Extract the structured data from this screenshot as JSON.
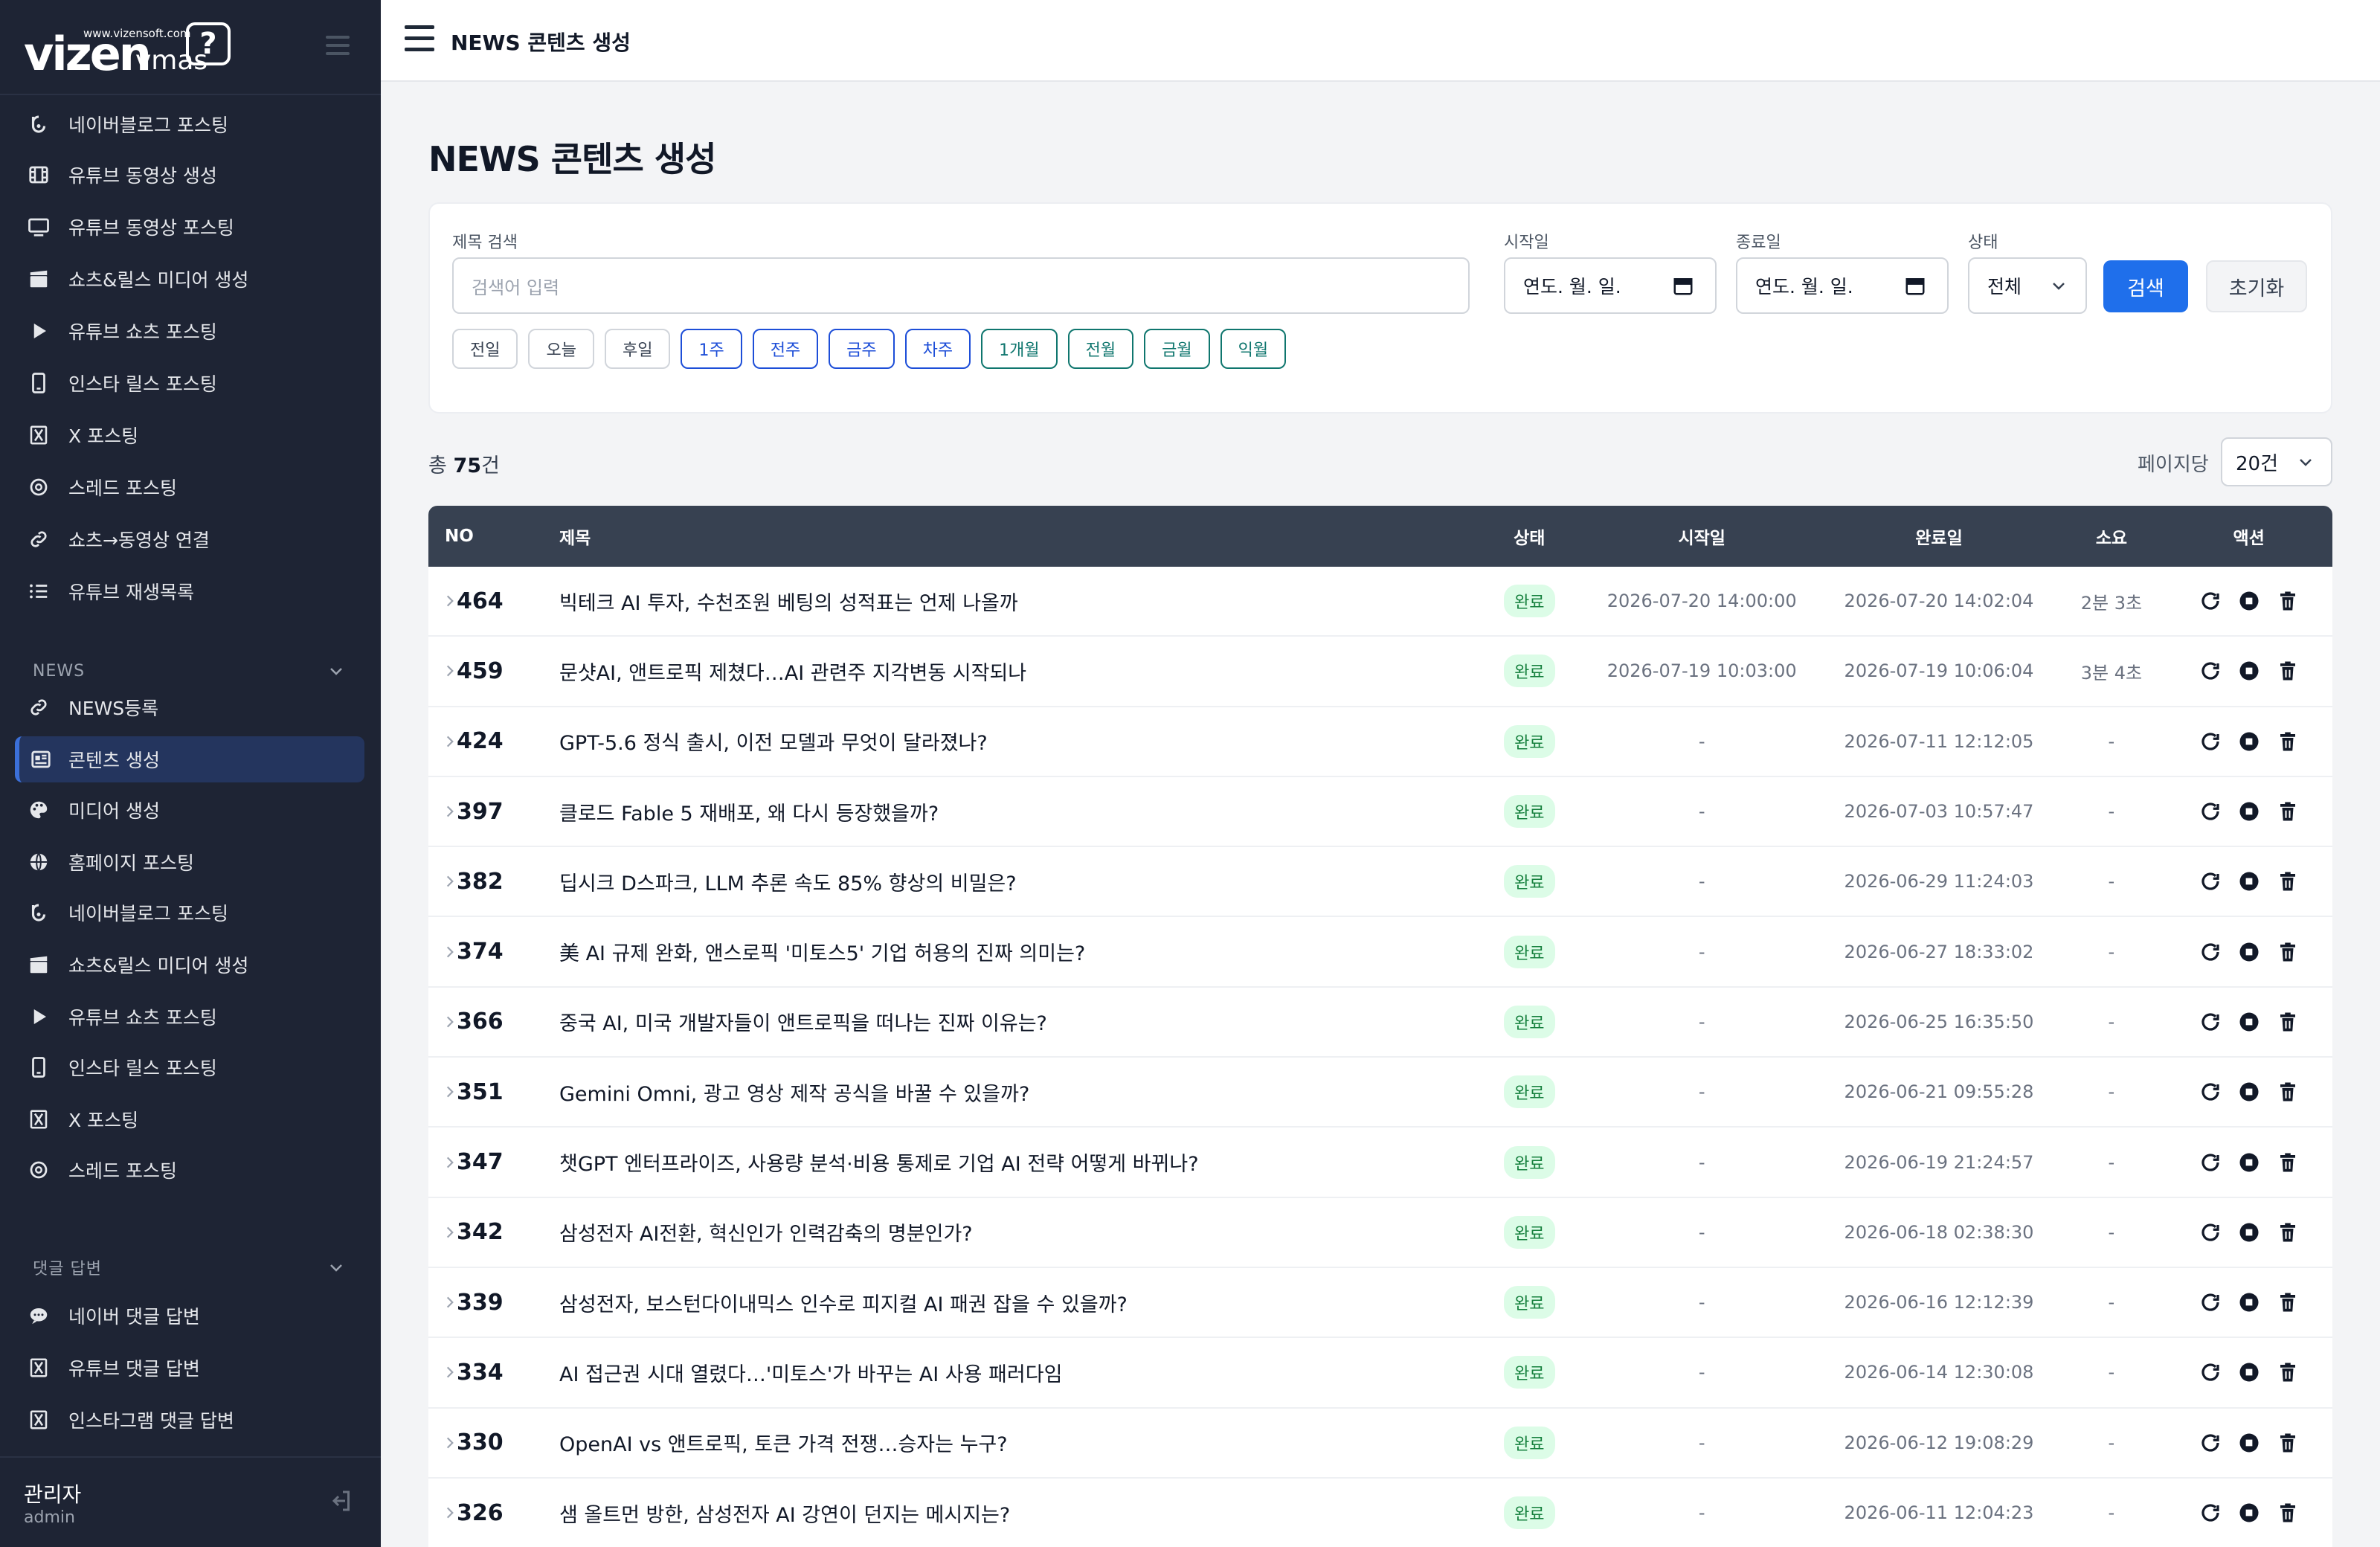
{
  "logo": {
    "url_text": "www.vizensoft.com",
    "brand": "vizen",
    "product": "vmas",
    "bubble": "?"
  },
  "sidebar": {
    "top_items": [
      {
        "label": "네이버블로그 포스팅",
        "icon": "blog-icon"
      },
      {
        "label": "유튜브 동영상 생성",
        "icon": "film-icon"
      },
      {
        "label": "유튜브 동영상 포스팅",
        "icon": "monitor-icon"
      },
      {
        "label": "쇼츠&릴스 미디어 생성",
        "icon": "clapperboard-icon"
      },
      {
        "label": "유튜브 쇼츠 포스팅",
        "icon": "play-icon"
      },
      {
        "label": "인스타 릴스 포스팅",
        "icon": "mobile-icon"
      },
      {
        "label": "X 포스팅",
        "icon": "x-logo-icon"
      },
      {
        "label": "스레드 포스팅",
        "icon": "threads-icon"
      },
      {
        "label": "쇼츠→동영상 연결",
        "icon": "link-icon"
      },
      {
        "label": "유튜브 재생목록",
        "icon": "list-icon"
      }
    ],
    "news_section": {
      "label": "NEWS",
      "items": [
        {
          "label": "NEWS등록",
          "icon": "link-icon"
        },
        {
          "label": "콘텐츠 생성",
          "icon": "newspaper-icon",
          "active": true
        },
        {
          "label": "미디어 생성",
          "icon": "palette-icon"
        },
        {
          "label": "홈페이지 포스팅",
          "icon": "globe-icon"
        },
        {
          "label": "네이버블로그 포스팅",
          "icon": "blog-icon"
        },
        {
          "label": "쇼츠&릴스 미디어 생성",
          "icon": "clapperboard-icon"
        },
        {
          "label": "유튜브 쇼츠 포스팅",
          "icon": "play-icon"
        },
        {
          "label": "인스타 릴스 포스팅",
          "icon": "mobile-icon"
        },
        {
          "label": "X 포스팅",
          "icon": "x-logo-icon"
        },
        {
          "label": "스레드 포스팅",
          "icon": "threads-icon"
        }
      ]
    },
    "reply_section": {
      "label": "댓글 답변",
      "items": [
        {
          "label": "네이버 댓글 답변",
          "icon": "comment-icon"
        },
        {
          "label": "유튜브 댓글 답변",
          "icon": "x-logo-icon"
        },
        {
          "label": "인스타그램 댓글 답변",
          "icon": "x-logo-icon"
        }
      ]
    },
    "user": {
      "name": "관리자",
      "id": "admin"
    }
  },
  "topbar": {
    "title": "NEWS 콘텐츠 생성"
  },
  "page": {
    "title": "NEWS 콘텐츠 생성"
  },
  "filters": {
    "title_label": "제목 검색",
    "title_placeholder": "검색어 입력",
    "start_label": "시작일",
    "start_value": "연도. 월. 일.",
    "end_label": "종료일",
    "end_value": "연도. 월. 일.",
    "status_label": "상태",
    "status_value": "전체",
    "search_button": "검색",
    "reset_button": "초기화",
    "chips": [
      {
        "label": "전일",
        "style": "gray"
      },
      {
        "label": "오늘",
        "style": "gray"
      },
      {
        "label": "후일",
        "style": "gray"
      },
      {
        "label": "1주",
        "style": "blue"
      },
      {
        "label": "전주",
        "style": "blue"
      },
      {
        "label": "금주",
        "style": "blue"
      },
      {
        "label": "차주",
        "style": "blue"
      },
      {
        "label": "1개월",
        "style": "green"
      },
      {
        "label": "전월",
        "style": "green"
      },
      {
        "label": "금월",
        "style": "green"
      },
      {
        "label": "익월",
        "style": "green"
      }
    ]
  },
  "summary": {
    "prefix": "총 ",
    "count": "75",
    "suffix": "건",
    "per_page_label": "페이지당",
    "per_page_value": "20건"
  },
  "table": {
    "headers": {
      "no": "NO",
      "title": "제목",
      "status": "상태",
      "start": "시작일",
      "end": "완료일",
      "duration": "소요",
      "actions": "액션"
    },
    "rows": [
      {
        "no": "464",
        "title": "빅테크 AI 투자, 수천조원 베팅의 성적표는 언제 나올까",
        "status": "완료",
        "start": "2026-07-20 14:00:00",
        "end": "2026-07-20 14:02:04",
        "duration": "2분 3초"
      },
      {
        "no": "459",
        "title": "문샷AI, 앤트로픽 제쳤다…AI 관련주 지각변동 시작되나",
        "status": "완료",
        "start": "2026-07-19 10:03:00",
        "end": "2026-07-19 10:06:04",
        "duration": "3분 4초"
      },
      {
        "no": "424",
        "title": "GPT-5.6 정식 출시, 이전 모델과 무엇이 달라졌나?",
        "status": "완료",
        "start": "-",
        "end": "2026-07-11 12:12:05",
        "duration": "-"
      },
      {
        "no": "397",
        "title": "클로드 Fable 5 재배포, 왜 다시 등장했을까?",
        "status": "완료",
        "start": "-",
        "end": "2026-07-03 10:57:47",
        "duration": "-"
      },
      {
        "no": "382",
        "title": "딥시크 D스파크, LLM 추론 속도 85% 향상의 비밀은?",
        "status": "완료",
        "start": "-",
        "end": "2026-06-29 11:24:03",
        "duration": "-"
      },
      {
        "no": "374",
        "title": "美 AI 규제 완화, 앤스로픽 '미토스5' 기업 허용의 진짜 의미는?",
        "status": "완료",
        "start": "-",
        "end": "2026-06-27 18:33:02",
        "duration": "-"
      },
      {
        "no": "366",
        "title": "중국 AI, 미국 개발자들이 앤트로픽을 떠나는 진짜 이유는?",
        "status": "완료",
        "start": "-",
        "end": "2026-06-25 16:35:50",
        "duration": "-"
      },
      {
        "no": "351",
        "title": "Gemini Omni, 광고 영상 제작 공식을 바꿀 수 있을까?",
        "status": "완료",
        "start": "-",
        "end": "2026-06-21 09:55:28",
        "duration": "-"
      },
      {
        "no": "347",
        "title": "챗GPT 엔터프라이즈, 사용량 분석·비용 통제로 기업 AI 전략 어떻게 바뀌나?",
        "status": "완료",
        "start": "-",
        "end": "2026-06-19 21:24:57",
        "duration": "-"
      },
      {
        "no": "342",
        "title": "삼성전자 AI전환, 혁신인가 인력감축의 명분인가?",
        "status": "완료",
        "start": "-",
        "end": "2026-06-18 02:38:30",
        "duration": "-"
      },
      {
        "no": "339",
        "title": "삼성전자, 보스턴다이내믹스 인수로 피지컬 AI 패권 잡을 수 있을까?",
        "status": "완료",
        "start": "-",
        "end": "2026-06-16 12:12:39",
        "duration": "-"
      },
      {
        "no": "334",
        "title": "AI 접근권 시대 열렸다…'미토스'가 바꾸는 AI 사용 패러다임",
        "status": "완료",
        "start": "-",
        "end": "2026-06-14 12:30:08",
        "duration": "-"
      },
      {
        "no": "330",
        "title": "OpenAI vs 앤트로픽, 토큰 가격 전쟁…승자는 누구?",
        "status": "완료",
        "start": "-",
        "end": "2026-06-12 19:08:29",
        "duration": "-"
      },
      {
        "no": "326",
        "title": "샘 올트먼 방한, 삼성전자 AI 강연이 던지는 메시지는?",
        "status": "완료",
        "start": "-",
        "end": "2026-06-11 12:04:23",
        "duration": "-"
      }
    ]
  },
  "colors": {
    "sidebar_bg": "#1e2434",
    "primary": "#1f6feb",
    "header_bg": "#374151",
    "badge_bg": "#dcfce7",
    "badge_text": "#15803d"
  }
}
